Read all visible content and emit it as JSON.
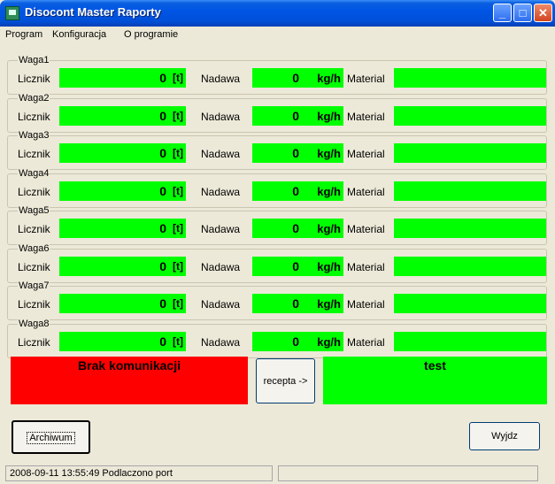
{
  "window": {
    "title": "Disocont Master Raporty"
  },
  "menu": [
    "Program",
    "Konfiguracja",
    "O programie"
  ],
  "labels": {
    "licznik": "Licznik",
    "nadawa": "Nadawa",
    "material": "Material",
    "unit_t": "[t]",
    "unit_kgh": "kg/h"
  },
  "scales": [
    {
      "name": "Waga1",
      "licznik": "0",
      "nadawa": "0",
      "material": ""
    },
    {
      "name": "Waga2",
      "licznik": "0",
      "nadawa": "0",
      "material": ""
    },
    {
      "name": "Waga3",
      "licznik": "0",
      "nadawa": "0",
      "material": ""
    },
    {
      "name": "Waga4",
      "licznik": "0",
      "nadawa": "0",
      "material": ""
    },
    {
      "name": "Waga5",
      "licznik": "0",
      "nadawa": "0",
      "material": ""
    },
    {
      "name": "Waga6",
      "licznik": "0",
      "nadawa": "0",
      "material": ""
    },
    {
      "name": "Waga7",
      "licznik": "0",
      "nadawa": "0",
      "material": ""
    },
    {
      "name": "Waga8",
      "licznik": "0",
      "nadawa": "0",
      "material": ""
    }
  ],
  "status_panels": {
    "communication": "Brak komunikacji",
    "recipe": "test"
  },
  "buttons": {
    "recepta": "recepta ->",
    "archiwum": "Archiwum",
    "wyjdz": "Wyjdz"
  },
  "statusbar": {
    "message": "2008-09-11 13:55:49 Podlaczono port",
    "right": ""
  },
  "colors": {
    "indicator_green": "#00ff00",
    "alarm_red": "#ff0000"
  }
}
